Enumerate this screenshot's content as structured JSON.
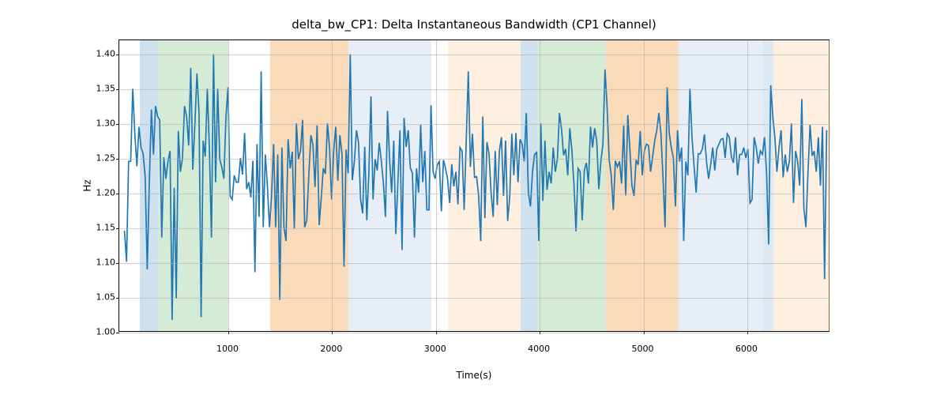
{
  "chart_data": {
    "type": "line",
    "title": "delta_bw_CP1: Delta Instantaneous Bandwidth (CP1 Channel)",
    "xlabel": "Time(s)",
    "ylabel": "Hz",
    "xticks": [
      1000,
      2000,
      3000,
      4000,
      5000,
      6000
    ],
    "yticks": [
      1.0,
      1.05,
      1.1,
      1.15,
      1.2,
      1.25,
      1.3,
      1.35,
      1.4
    ],
    "xlim": [
      -50,
      6800
    ],
    "ylim": [
      1.0,
      1.42
    ],
    "bands": [
      {
        "x0": 150,
        "x1": 320,
        "color": "#a7c7e0",
        "alpha": 0.55
      },
      {
        "x0": 320,
        "x1": 1000,
        "color": "#b3dbb3",
        "alpha": 0.55
      },
      {
        "x0": 1400,
        "x1": 2160,
        "color": "#f5c28a",
        "alpha": 0.6
      },
      {
        "x0": 2160,
        "x1": 2960,
        "color": "#c9d9ea",
        "alpha": 0.45
      },
      {
        "x0": 3120,
        "x1": 3820,
        "color": "#fde0c2",
        "alpha": 0.5
      },
      {
        "x0": 3820,
        "x1": 3980,
        "color": "#a7c7e0",
        "alpha": 0.55
      },
      {
        "x0": 3980,
        "x1": 4640,
        "color": "#b3dbb3",
        "alpha": 0.55
      },
      {
        "x0": 4640,
        "x1": 5340,
        "color": "#f5c28a",
        "alpha": 0.6
      },
      {
        "x0": 5340,
        "x1": 6150,
        "color": "#c9d9ea",
        "alpha": 0.45
      },
      {
        "x0": 6150,
        "x1": 6250,
        "color": "#a7c7e0",
        "alpha": 0.4
      },
      {
        "x0": 6250,
        "x1": 6800,
        "color": "#fde0c2",
        "alpha": 0.5
      }
    ],
    "series": [
      {
        "name": "delta_bw_CP1",
        "color": "#1f77b4",
        "x_step": 20,
        "x_start": 0,
        "values": [
          1.145,
          1.1,
          1.245,
          1.245,
          1.35,
          1.285,
          1.238,
          1.295,
          1.265,
          1.256,
          1.223,
          1.089,
          1.215,
          1.32,
          1.255,
          1.325,
          1.31,
          1.305,
          1.135,
          1.251,
          1.22,
          1.245,
          1.26,
          1.016,
          1.207,
          1.047,
          1.289,
          1.23,
          1.25,
          1.325,
          1.31,
          1.268,
          1.38,
          1.233,
          1.299,
          1.372,
          1.315,
          1.02,
          1.275,
          1.252,
          1.35,
          1.263,
          1.135,
          1.4,
          1.215,
          1.35,
          1.248,
          1.237,
          1.22,
          1.31,
          1.352,
          1.195,
          1.19,
          1.225,
          1.215,
          1.215,
          1.25,
          1.226,
          1.286,
          1.205,
          1.215,
          1.193,
          1.246,
          1.085,
          1.27,
          1.165,
          1.375,
          1.15,
          1.255,
          1.21,
          1.15,
          1.195,
          1.27,
          1.15,
          1.255,
          1.045,
          1.265,
          1.15,
          1.13,
          1.277,
          1.235,
          1.259,
          1.148,
          1.3,
          1.248,
          1.261,
          1.305,
          1.15,
          1.16,
          1.225,
          1.283,
          1.269,
          1.208,
          1.297,
          1.153,
          1.192,
          1.235,
          1.227,
          1.3,
          1.265,
          1.19,
          1.26,
          1.295,
          1.217,
          1.283,
          1.256,
          1.093,
          1.262,
          1.228,
          1.4,
          1.218,
          1.245,
          1.29,
          1.272,
          1.19,
          1.17,
          1.266,
          1.16,
          1.23,
          1.339,
          1.19,
          1.248,
          1.232,
          1.272,
          1.246,
          1.214,
          1.165,
          1.318,
          1.248,
          1.2,
          1.275,
          1.14,
          1.215,
          1.29,
          1.117,
          1.308,
          1.266,
          1.29,
          1.236,
          1.228,
          1.135,
          1.235,
          1.2,
          1.298,
          1.215,
          1.26,
          1.175,
          1.175,
          1.326,
          1.23,
          1.22,
          1.24,
          1.245,
          1.173,
          1.247,
          1.235,
          1.219,
          1.185,
          1.241,
          1.209,
          1.23,
          1.183,
          1.265,
          1.26,
          1.175,
          1.275,
          1.375,
          1.237,
          1.285,
          1.222,
          1.223,
          1.195,
          1.13,
          1.31,
          1.163,
          1.273,
          1.256,
          1.2,
          1.165,
          1.26,
          1.182,
          1.26,
          1.28,
          1.195,
          1.275,
          1.159,
          1.194,
          1.285,
          1.225,
          1.286,
          1.215,
          1.277,
          1.27,
          1.245,
          1.315,
          1.2,
          1.18,
          1.23,
          1.255,
          1.258,
          1.13,
          1.3,
          1.188,
          1.275,
          1.204,
          1.23,
          1.213,
          1.265,
          1.23,
          1.248,
          1.315,
          1.292,
          1.254,
          1.263,
          1.225,
          1.293,
          1.261,
          1.212,
          1.144,
          1.235,
          1.23,
          1.16,
          1.232,
          1.243,
          1.213,
          1.295,
          1.265,
          1.293,
          1.275,
          1.205,
          1.245,
          1.27,
          1.378,
          1.325,
          1.248,
          1.225,
          1.175,
          1.246,
          1.237,
          1.245,
          1.213,
          1.297,
          1.196,
          1.312,
          1.263,
          1.21,
          1.195,
          1.247,
          1.24,
          1.289,
          1.225,
          1.26,
          1.27,
          1.268,
          1.23,
          1.252,
          1.275,
          1.29,
          1.315,
          1.285,
          1.221,
          1.15,
          1.352,
          1.286,
          1.265,
          1.25,
          1.18,
          1.29,
          1.245,
          1.265,
          1.13,
          1.245,
          1.225,
          1.35,
          1.28,
          1.238,
          1.2,
          1.256,
          1.256,
          1.263,
          1.284,
          1.245,
          1.22,
          1.24,
          1.265,
          1.232,
          1.263,
          1.27,
          1.277,
          1.278,
          1.25,
          1.285,
          1.28,
          1.252,
          1.243,
          1.28,
          1.225,
          1.255,
          1.255,
          1.265,
          1.25,
          1.263,
          1.185,
          1.19,
          1.28,
          1.265,
          1.242,
          1.26,
          1.255,
          1.28,
          1.228,
          1.125,
          1.355,
          1.31,
          1.28,
          1.23,
          1.265,
          1.29,
          1.222,
          1.255,
          1.23,
          1.245,
          1.3,
          1.185,
          1.26,
          1.245,
          1.21,
          1.335,
          1.178,
          1.15,
          1.23,
          1.298,
          1.253,
          1.26,
          1.23,
          1.28,
          1.21,
          1.295,
          1.075,
          1.29
        ]
      }
    ]
  }
}
